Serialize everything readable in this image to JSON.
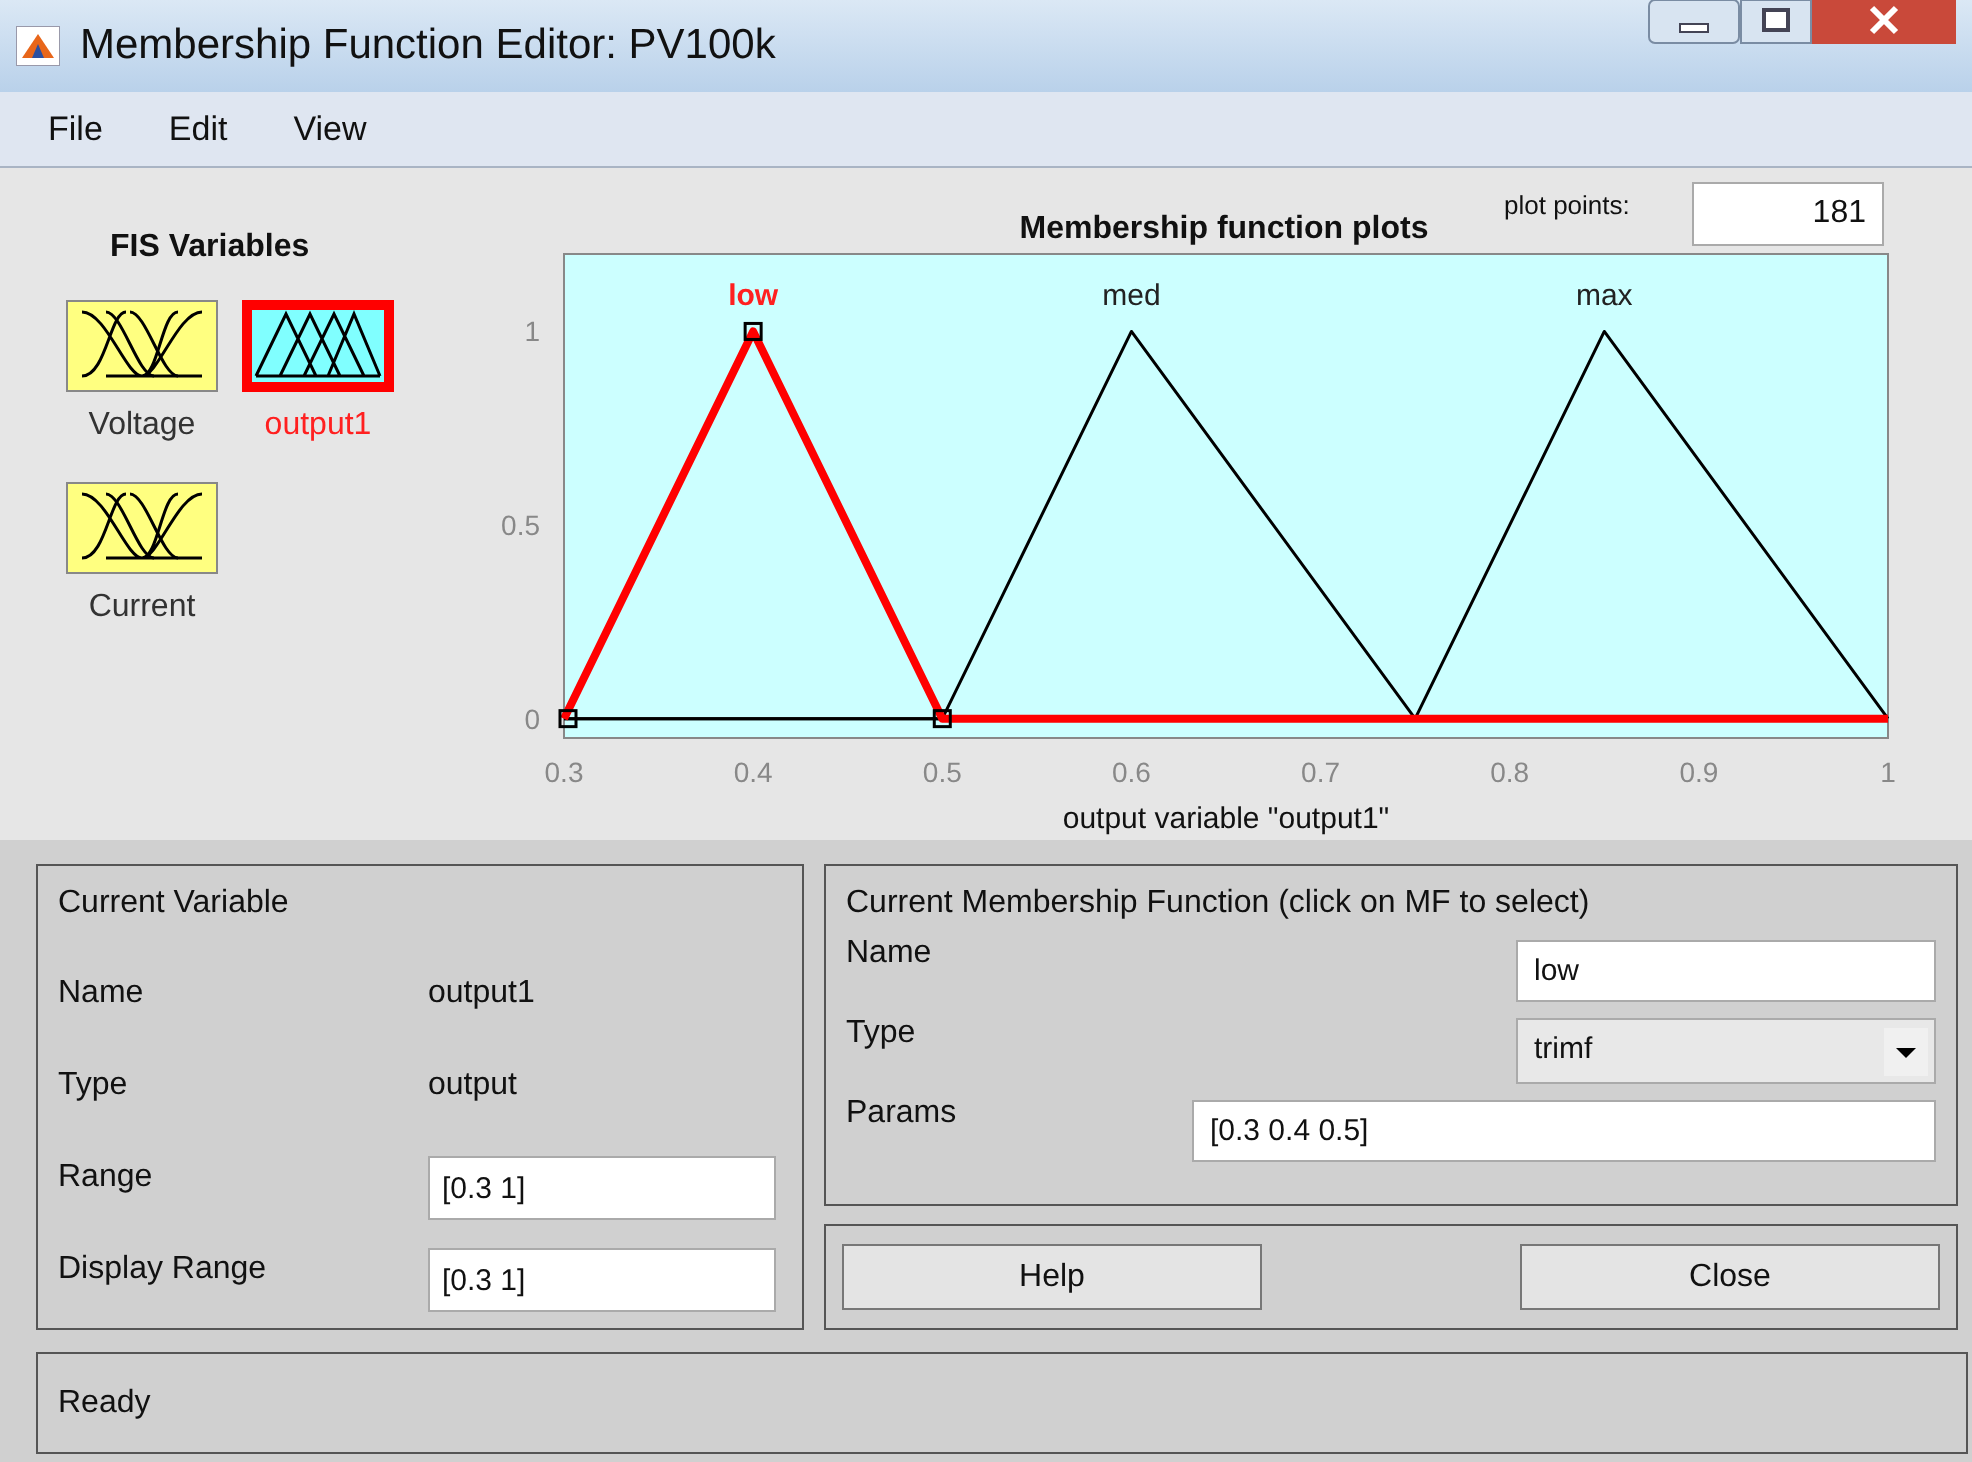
{
  "window": {
    "title": "Membership Function Editor: PV100k"
  },
  "menu": [
    "File",
    "Edit",
    "View"
  ],
  "fis_variables": {
    "title": "FIS Variables",
    "items": [
      {
        "name": "Voltage",
        "kind": "input",
        "selected": false
      },
      {
        "name": "output1",
        "kind": "output",
        "selected": true
      },
      {
        "name": "Current",
        "kind": "input",
        "selected": false
      }
    ]
  },
  "plot": {
    "plot_points_label": "plot points:",
    "plot_points": "181",
    "chart_data": {
      "type": "line",
      "title": "Membership function plots",
      "xlabel": "output variable \"output1\"",
      "x": [
        0.3,
        0.4,
        0.5,
        0.6,
        0.75,
        0.85,
        1
      ],
      "xlim": [
        0.3,
        1
      ],
      "ylim": [
        -0.05,
        1.2
      ],
      "xticks": [
        0.3,
        0.4,
        0.5,
        0.6,
        0.7,
        0.8,
        0.9,
        1
      ],
      "yticks": [
        0,
        0.5,
        1
      ],
      "series": [
        {
          "name": "low",
          "color": "#ff0000",
          "values": [
            0,
            1,
            0,
            0,
            0,
            0,
            0
          ]
        },
        {
          "name": "med",
          "color": "#000000",
          "values": [
            0,
            0,
            0,
            1,
            0,
            0,
            0
          ]
        },
        {
          "name": "max",
          "color": "#000000",
          "values": [
            0,
            0,
            0,
            0,
            0,
            1,
            0
          ]
        }
      ]
    }
  },
  "current_variable": {
    "title": "Current Variable",
    "name_label": "Name",
    "name": "output1",
    "type_label": "Type",
    "type": "output",
    "range_label": "Range",
    "range": "[0.3 1]",
    "display_range_label": "Display Range",
    "display_range": "[0.3 1]"
  },
  "current_mf": {
    "title": "Current Membership Function (click on MF to select)",
    "name_label": "Name",
    "name": "low",
    "type_label": "Type",
    "type": "trimf",
    "params_label": "Params",
    "params": "[0.3 0.4 0.5]"
  },
  "buttons": [
    "Help",
    "Close"
  ],
  "status": "Ready"
}
